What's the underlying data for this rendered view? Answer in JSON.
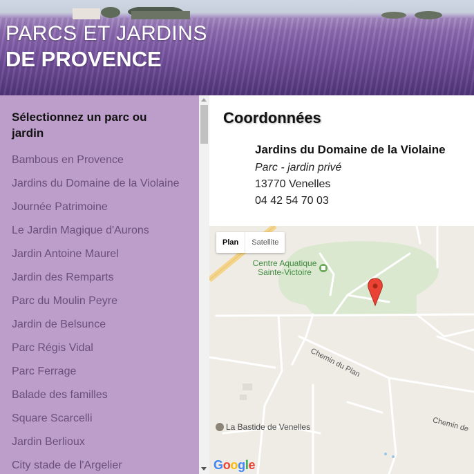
{
  "header": {
    "title_line1": "PARCS ET JARDINS",
    "title_line2": "DE PROVENCE"
  },
  "sidebar": {
    "heading": "Sélectionnez un parc ou jardin",
    "items": [
      {
        "label": "Bambous en Provence"
      },
      {
        "label": "Jardins du Domaine de la Violaine"
      },
      {
        "label": "Journée Patrimoine"
      },
      {
        "label": "Le Jardin Magique d'Aurons"
      },
      {
        "label": "Jardin Antoine Maurel"
      },
      {
        "label": "Jardin des Remparts"
      },
      {
        "label": "Parc du Moulin Peyre"
      },
      {
        "label": "Jardin de Belsunce"
      },
      {
        "label": "Parc Régis Vidal"
      },
      {
        "label": "Parc Ferrage"
      },
      {
        "label": "Balade des familles"
      },
      {
        "label": "Square Scarcelli"
      },
      {
        "label": "Jardin Berlioux"
      },
      {
        "label": "City stade de l'Argelier"
      }
    ]
  },
  "details": {
    "heading": "Coordonnées",
    "name": "Jardins du Domaine de la Violaine",
    "type": "Parc - jardin privé",
    "city": "13770 Venelles",
    "phone": "04 42 54 70 03"
  },
  "map": {
    "plan_label": "Plan",
    "satellite_label": "Satellite",
    "poi_center": "Centre Aquatique Sainte-Victoire",
    "road_label": "Chemin du Plan",
    "road_label_2": "Chemin de",
    "poi_bastide": "La Bastide de Venelles",
    "logo": "Google",
    "colors": {
      "park": "#d9e8cf",
      "road": "#ffffff",
      "major_road": "#f6d68c",
      "marker": "#ea4335",
      "sidebar_bg": "#bd9ecb",
      "sidebar_text": "#6b4f7b"
    }
  }
}
